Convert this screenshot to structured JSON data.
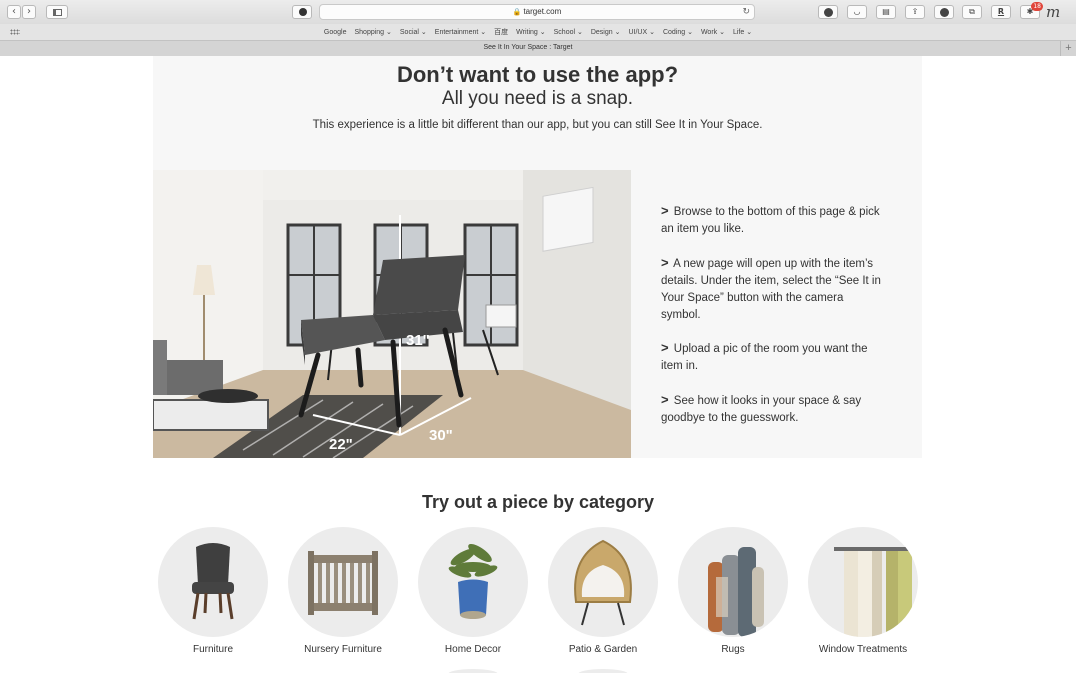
{
  "browser": {
    "url": "target.com",
    "tab_title": "See It In Your Space : Target",
    "favorites": [
      "Google",
      "Shopping ⌄",
      "Social ⌄",
      "Entertainment ⌄",
      "百度",
      "Writing ⌄",
      "School ⌄",
      "Design ⌄",
      "UI/UX ⌄",
      "Coding ⌄",
      "Work ⌄",
      "Life ⌄"
    ],
    "toolbar_icons": [
      "download-icon",
      "pocket-icon",
      "reader-icon",
      "share-icon",
      "adblock-icon",
      "tabs-icon",
      "r-extension-icon",
      "extension-badge-icon",
      "m-extension-icon"
    ],
    "ext_r_label": "R",
    "ext_m_label": "m",
    "badge_count": "18"
  },
  "hero": {
    "title": "Don’t want to use the app?",
    "subtitle": "All you need is a snap.",
    "description": "This experience is a little bit different than our app, but you can still See It in Your Space."
  },
  "room_image": {
    "dim_height": "31\"",
    "dim_width": "22\"",
    "dim_depth": "30\""
  },
  "steps": [
    {
      "marker": ">",
      "text": "Browse to the bottom of this page & pick an item you like."
    },
    {
      "marker": ">",
      "text": "A new page will open up with the item’s details. Under the item, select the “See It in Your Space” button with the camera symbol."
    },
    {
      "marker": ">",
      "text": "Upload a pic of the room you want the item in."
    },
    {
      "marker": ">",
      "text": "See how it looks in your space & say goodbye to the guesswork."
    }
  ],
  "categories_section": {
    "title": "Try out a piece by category",
    "items": [
      {
        "label": "Furniture",
        "icon": "chair-image"
      },
      {
        "label": "Nursery Furniture",
        "icon": "crib-image"
      },
      {
        "label": "Home Decor",
        "icon": "plant-vase-image"
      },
      {
        "label": "Patio & Garden",
        "icon": "egg-chair-image"
      },
      {
        "label": "Rugs",
        "icon": "rolled-rugs-image"
      },
      {
        "label": "Window Treatments",
        "icon": "curtains-image"
      }
    ]
  }
}
